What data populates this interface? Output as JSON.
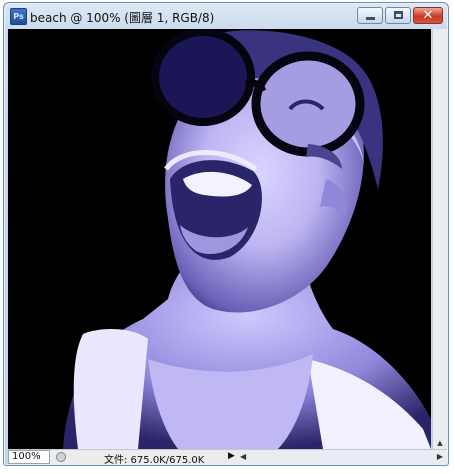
{
  "window": {
    "title": "beach @ 100% (圖層 1, RGB/8)",
    "app_icon": "Ps"
  },
  "controls": {
    "minimize": "minimize-icon",
    "maximize": "maximize-icon",
    "close": "close-icon"
  },
  "status": {
    "zoom": "100%",
    "doc_size": "文件: 675.0K/675.0K"
  },
  "scroll": {
    "left_arrow": "◀",
    "right_arrow": "▶",
    "menu_arrow": "▶",
    "up_arrow": "▲"
  },
  "colors": {
    "tint": "#c9c2ff",
    "background": "#000000",
    "title_gradient_top": "#dfe9f5",
    "close_red": "#c63a26"
  }
}
